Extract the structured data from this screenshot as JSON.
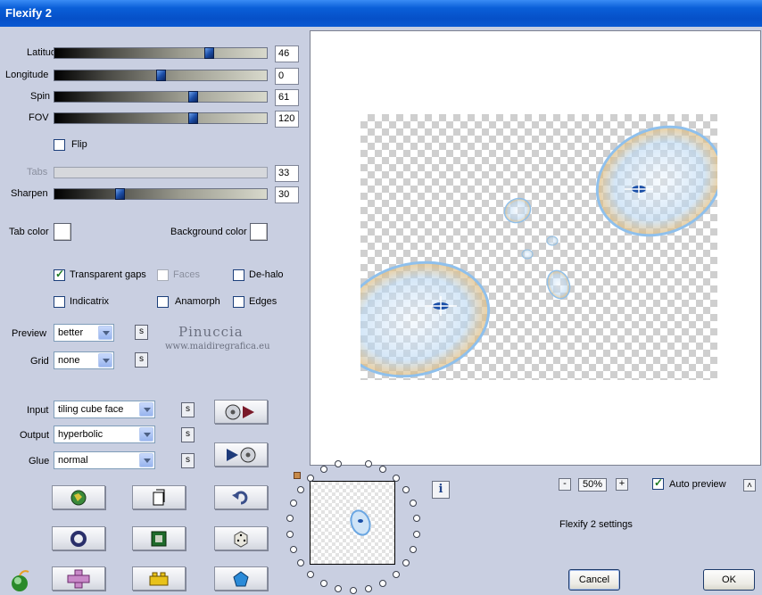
{
  "window": {
    "title": "Flexify 2"
  },
  "sliders": [
    {
      "label": "Latitude",
      "value": "46",
      "fraction": 0.74,
      "enabled": true
    },
    {
      "label": "Longitude",
      "value": "0",
      "fraction": 0.5,
      "enabled": true
    },
    {
      "label": "Spin",
      "value": "61",
      "fraction": 0.66,
      "enabled": true
    },
    {
      "label": "FOV",
      "value": "120",
      "fraction": 0.66,
      "enabled": true
    },
    {
      "label": "Tabs",
      "value": "33",
      "fraction": 0.0,
      "enabled": false
    },
    {
      "label": "Sharpen",
      "value": "30",
      "fraction": 0.3,
      "enabled": true
    }
  ],
  "flip": {
    "label": "Flip",
    "checked": false
  },
  "colors": {
    "tab_color_label": "Tab color",
    "background_color_label": "Background color",
    "tab_color": "#ffffff",
    "background_color": "#ffffff"
  },
  "options": {
    "transparent_gaps": {
      "label": "Transparent gaps",
      "checked": true
    },
    "faces": {
      "label": "Faces",
      "checked": false,
      "enabled": false
    },
    "de_halo": {
      "label": "De-halo",
      "checked": false
    },
    "indicatrix": {
      "label": "Indicatrix",
      "checked": false
    },
    "anamorph": {
      "label": "Anamorph",
      "checked": false
    },
    "edges": {
      "label": "Edges",
      "checked": false
    }
  },
  "preview_select": {
    "label": "Preview",
    "value": "better"
  },
  "grid_select": {
    "label": "Grid",
    "value": "none"
  },
  "input_select": {
    "label": "Input",
    "value": "tiling cube face"
  },
  "output_select": {
    "label": "Output",
    "value": "hyperbolic"
  },
  "glue_select": {
    "label": "Glue",
    "value": "normal"
  },
  "s_button_label": "s",
  "watermark": {
    "line1": "Pinuccia",
    "line2": "www.maidiregrafica.eu"
  },
  "zoom": {
    "minus": "-",
    "value": "50%",
    "plus": "+"
  },
  "auto_preview": {
    "label": "Auto preview",
    "checked": true
  },
  "collapse_button": "˄",
  "settings_label": "Flexify 2 settings",
  "info_button": "i",
  "buttons": {
    "cancel": "Cancel",
    "ok": "OK"
  }
}
